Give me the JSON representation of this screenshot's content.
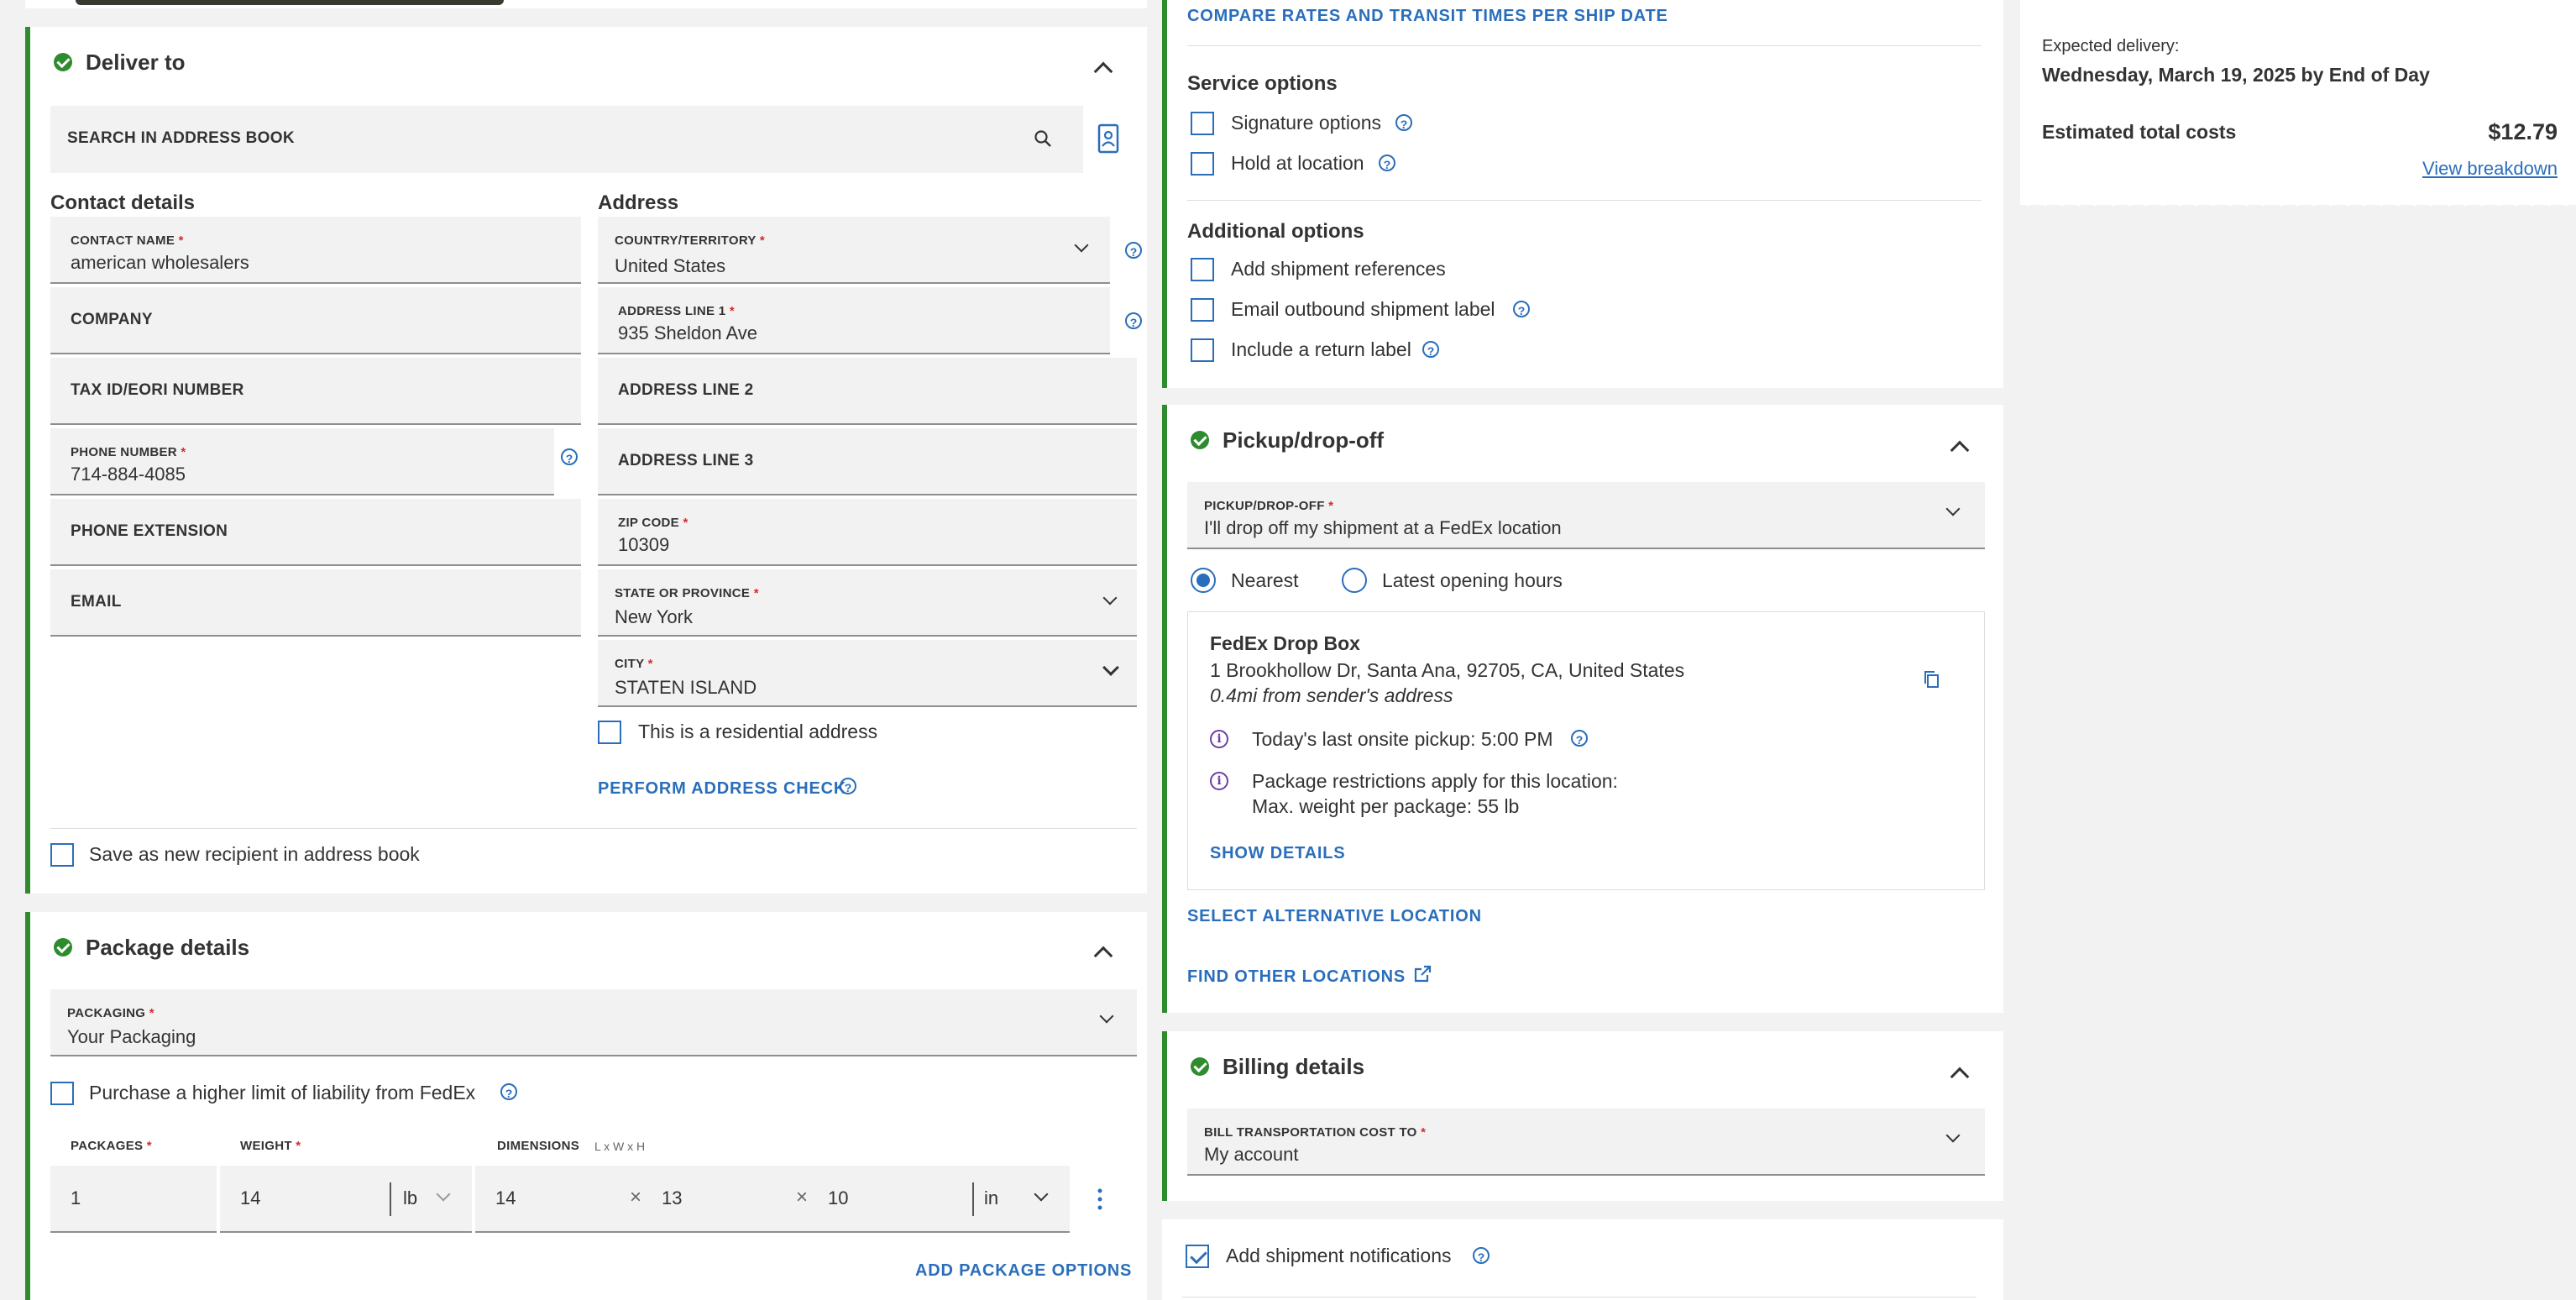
{
  "deliver_to": {
    "title": "Deliver to",
    "search_placeholder": "SEARCH IN ADDRESS BOOK",
    "contact_heading": "Contact details",
    "address_heading": "Address",
    "contact_name": {
      "label": "CONTACT NAME",
      "value": "american wholesalers"
    },
    "company": {
      "label": "COMPANY"
    },
    "tax_id": {
      "label": "TAX ID/EORI NUMBER"
    },
    "phone": {
      "label": "PHONE NUMBER",
      "value": "714-884-4085"
    },
    "phone_ext": {
      "label": "PHONE EXTENSION"
    },
    "email": {
      "label": "EMAIL"
    },
    "country": {
      "label": "COUNTRY/TERRITORY",
      "value": "United States"
    },
    "address1": {
      "label": "ADDRESS LINE 1",
      "value": "935 Sheldon Ave"
    },
    "address2": {
      "label": "ADDRESS LINE 2"
    },
    "address3": {
      "label": "ADDRESS LINE 3"
    },
    "zip": {
      "label": "ZIP CODE",
      "value": "10309"
    },
    "state": {
      "label": "STATE OR PROVINCE",
      "value": "New York"
    },
    "city": {
      "label": "CITY",
      "value": "STATEN ISLAND"
    },
    "residential_label": "This is a residential address",
    "address_check": "PERFORM ADDRESS CHECK",
    "save_recipient": "Save as new recipient in address book"
  },
  "package": {
    "title": "Package details",
    "packaging": {
      "label": "PACKAGING",
      "value": "Your Packaging"
    },
    "liability": "Purchase a higher limit of liability from FedEx",
    "col_packages": "PACKAGES",
    "col_weight": "WEIGHT",
    "col_dimensions": "DIMENSIONS",
    "dim_hint": "L x W x H",
    "packages_value": "1",
    "weight_value": "14",
    "weight_unit": "lb",
    "dim_l": "14",
    "dim_w": "13",
    "dim_h": "10",
    "dim_unit": "in",
    "add_options": "ADD PACKAGE OPTIONS"
  },
  "service": {
    "compare_link": "COMPARE RATES AND TRANSIT TIMES PER SHIP DATE",
    "service_heading": "Service options",
    "signature": "Signature options",
    "hold": "Hold at location",
    "additional_heading": "Additional options",
    "references": "Add shipment references",
    "email_label": "Email outbound shipment label",
    "return_label": "Include a return label"
  },
  "pickup": {
    "title": "Pickup/drop-off",
    "select_label": "PICKUP/DROP-OFF",
    "select_value": "I'll drop off my shipment at a FedEx location",
    "radio_nearest": "Nearest",
    "radio_latest": "Latest opening hours",
    "location_name": "FedEx Drop Box",
    "location_address": "1 Brookhollow Dr, Santa Ana, 92705, CA, United States",
    "location_distance": "0.4mi from sender's address",
    "last_pickup": "Today's last onsite pickup: 5:00 PM",
    "restrictions": "Package restrictions apply for this location:",
    "max_weight": "Max. weight per package: 55 lb",
    "show_details": "SHOW DETAILS",
    "select_alt": "SELECT ALTERNATIVE LOCATION",
    "find_other": "FIND OTHER LOCATIONS"
  },
  "billing": {
    "title": "Billing details",
    "label": "BILL TRANSPORTATION COST TO",
    "value": "My account"
  },
  "notifications": {
    "label": "Add shipment notifications"
  },
  "summary": {
    "expected_label": "Expected delivery:",
    "expected_value": "Wednesday, March 19, 2025 by End of Day",
    "total_label": "Estimated total costs",
    "total_value": "$12.79",
    "breakdown": "View breakdown"
  },
  "colors": {
    "accent": "#2a6ebb",
    "success": "#2e8b2e",
    "required": "#d62b2b"
  }
}
